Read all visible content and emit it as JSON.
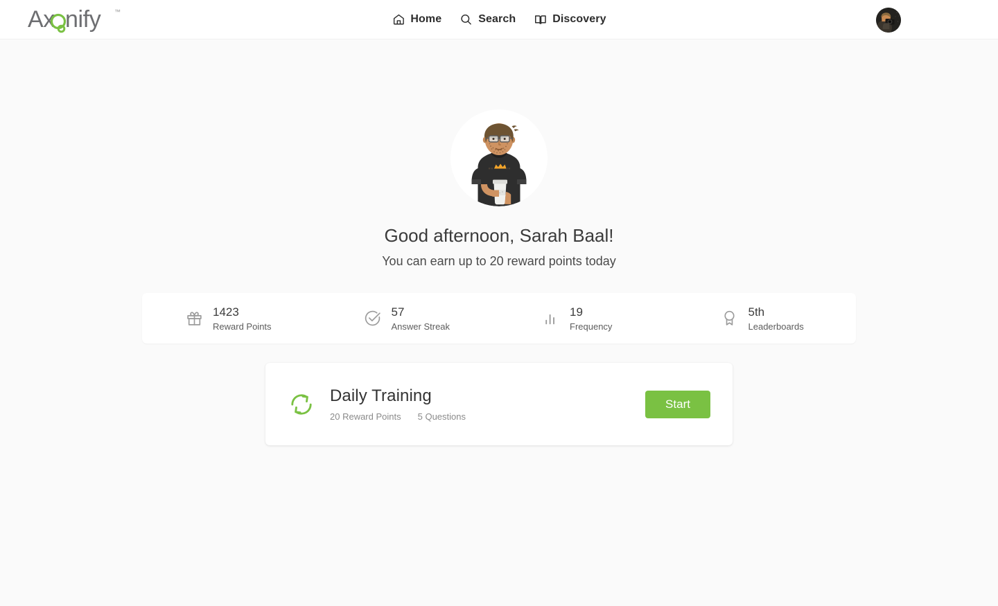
{
  "brand": {
    "logo_text": "Axonify",
    "trademark": "™",
    "logo_gray": "#6d6e71",
    "logo_green": "#7ac143"
  },
  "header": {
    "nav": [
      {
        "label": "Home",
        "icon": "home-icon"
      },
      {
        "label": "Search",
        "icon": "search-icon"
      },
      {
        "label": "Discovery",
        "icon": "book-icon"
      }
    ],
    "avatar_name": "user-avatar"
  },
  "hero": {
    "avatar_name": "profile-illustration",
    "greeting": "Good afternoon, Sarah Baal!",
    "subgreeting": "You can earn up to 20 reward points today"
  },
  "stats": [
    {
      "value": "1423",
      "label": "Reward Points",
      "icon": "gift-icon"
    },
    {
      "value": "57",
      "label": "Answer Streak",
      "icon": "check-circle-icon"
    },
    {
      "value": "19",
      "label": "Frequency",
      "icon": "bar-chart-icon"
    },
    {
      "value": "5th",
      "label": "Leaderboards",
      "icon": "award-icon"
    }
  ],
  "training": {
    "icon": "refresh-icon",
    "title": "Daily Training",
    "reward_points": "20 Reward Points",
    "questions": "5 Questions",
    "start_label": "Start",
    "accent_color": "#7ac143"
  }
}
